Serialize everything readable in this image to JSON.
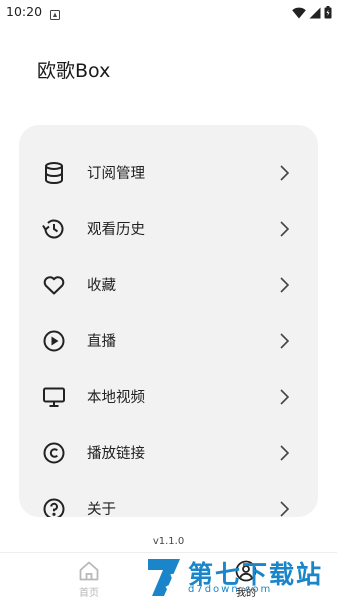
{
  "status_bar": {
    "time": "10:20",
    "icons": [
      "notification-icon",
      "wifi-icon",
      "cellular-icon",
      "battery-icon"
    ]
  },
  "app": {
    "title": "欧歌Box"
  },
  "menu": {
    "items": [
      {
        "label": "订阅管理",
        "icon": "database-icon"
      },
      {
        "label": "观看历史",
        "icon": "history-icon"
      },
      {
        "label": "收藏",
        "icon": "heart-icon"
      },
      {
        "label": "直播",
        "icon": "play-circle-icon"
      },
      {
        "label": "本地视频",
        "icon": "monitor-icon"
      },
      {
        "label": "播放链接",
        "icon": "copyright-icon"
      },
      {
        "label": "关于",
        "icon": "help-circle-icon"
      }
    ]
  },
  "version": "v1.1.0",
  "bottom_nav": {
    "tabs": [
      {
        "label": "首页",
        "icon": "home-icon",
        "active": false
      },
      {
        "label": "我的",
        "icon": "user-icon",
        "active": true
      }
    ]
  },
  "watermark": {
    "text": "第七下载站",
    "url": "d7down.com"
  },
  "colors": {
    "card_bg": "#f2f2f2",
    "watermark_blue": "#1a86c9",
    "inactive_tab": "#b8b8b8"
  }
}
